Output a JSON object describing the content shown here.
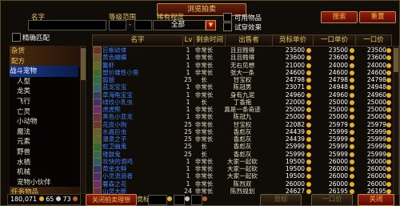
{
  "window": {
    "title": "浏览拍卖"
  },
  "filters": {
    "name_label": "名字",
    "level_label": "等级范围",
    "level_sep": "-",
    "rarity_label": "稀有程度",
    "rarity_value": "全部",
    "usable_label": "可用物品",
    "preview_label": "试穿效果",
    "exact_label": "精确匹配",
    "search_button": "搜索",
    "reset_button": "重置"
  },
  "columns": {
    "name": "名字",
    "level": "Lv",
    "time": "剩余时间",
    "seller": "出售者",
    "bid": "竞标单价",
    "buyout": "一口单价",
    "buyout2": "一口价"
  },
  "categories": [
    {
      "label": "杂货",
      "type": "main"
    },
    {
      "label": "配方",
      "type": "main"
    },
    {
      "label": "战斗宠物",
      "type": "sel"
    },
    {
      "label": "人型",
      "type": "sub"
    },
    {
      "label": "龙类",
      "type": "sub"
    },
    {
      "label": "飞行",
      "type": "sub"
    },
    {
      "label": "亡灵",
      "type": "sub"
    },
    {
      "label": "小动物",
      "type": "sub"
    },
    {
      "label": "魔法",
      "type": "sub"
    },
    {
      "label": "元素",
      "type": "sub"
    },
    {
      "label": "野兽",
      "type": "sub"
    },
    {
      "label": "水栖",
      "type": "sub"
    },
    {
      "label": "机械",
      "type": "sub"
    },
    {
      "label": "宠物小伙伴",
      "type": "sub"
    },
    {
      "label": "任务物品",
      "type": "main"
    }
  ],
  "rows": [
    {
      "name": "巨蜥幼体",
      "lv": "1",
      "time": "非常长",
      "seller": "且且贱得",
      "bid": "23500",
      "buy": "23500",
      "buy2": "23500",
      "color": "#3a80ff"
    },
    {
      "name": "黄色蝴蝶",
      "lv": "1",
      "time": "非常长",
      "seller": "且且贱得",
      "bid": "23600",
      "buy": "23600",
      "buy2": "23600",
      "color": "#3a80ff"
    },
    {
      "name": "鳌虾",
      "lv": "1",
      "time": "非常长",
      "seller": "无右见想",
      "bid": "21000",
      "buy": "24000",
      "buy2": "24000",
      "color": "#3a80ff"
    },
    {
      "name": "塑价雄性小鱼",
      "lv": "1",
      "time": "非常长",
      "seller": "张大一条",
      "bid": "24600",
      "buy": "24600",
      "buy2": "24600",
      "color": "#3a80ff"
    },
    {
      "name": "狐狼",
      "lv": "25",
      "time": "长",
      "seller": "甘宝权",
      "bid": "24798",
      "buy": "24798",
      "buy2": "24798",
      "color": "#3a80ff"
    },
    {
      "name": "蓝龙宝宝",
      "lv": "1",
      "time": "非常长",
      "seller": "陈冠男",
      "bid": "23071",
      "buy": "24948",
      "buy2": "24948",
      "color": "#3a80ff"
    },
    {
      "name": "草海龟宝宝",
      "lv": "1",
      "time": "非常长",
      "seller": "身有九泥",
      "bid": "24960",
      "buy": "24960",
      "buy2": "24960",
      "color": "#3a80ff"
    },
    {
      "name": "绿纹小乳虫",
      "lv": "1",
      "time": "长",
      "seller": "丁香拖",
      "bid": "22000",
      "buy": "25000",
      "buy2": "25000",
      "color": "#3a80ff"
    },
    {
      "name": "虎虎熊",
      "lv": "1",
      "time": "非常长",
      "seller": "真是一条奇迹",
      "bid": "25000",
      "buy": "25000",
      "buy2": "25000",
      "color": "#3a80ff"
    },
    {
      "name": "黑色小亚龙",
      "lv": "1",
      "time": "非常长",
      "seller": "陈冠九",
      "bid": "25000",
      "buy": "25000",
      "buy2": "25000",
      "color": "#3a80ff"
    },
    {
      "name": "花皮小狗",
      "lv": "25",
      "time": "非常长",
      "seller": "甘宝权",
      "bid": "22082",
      "buy": "25979",
      "buy2": "25979",
      "color": "#3a80ff"
    },
    {
      "name": "水晶巨虫",
      "lv": "25",
      "time": "非常长",
      "seller": "香彪灰",
      "bid": "24439",
      "buy": "25999",
      "buy2": "25999",
      "color": "#3a80ff"
    },
    {
      "name": "潮泉之子",
      "lv": "25",
      "time": "非常长",
      "seller": "香彪灰",
      "bid": "24439",
      "buy": "25999",
      "buy2": "25999",
      "color": "#3a80ff"
    },
    {
      "name": "蛇卫幽鬼",
      "lv": "25",
      "time": "长",
      "seller": "香彪灰",
      "bid": "25999",
      "buy": "25999",
      "buy2": "25999",
      "color": "#3a80ff"
    },
    {
      "name": "锥鼓鬼",
      "lv": "25",
      "time": "长",
      "seller": "香彪灰",
      "bid": "25999",
      "buy": "25999",
      "buy2": "25999",
      "color": "#3a80ff"
    },
    {
      "name": "欢快的酒鸡",
      "lv": "1",
      "time": "非常长",
      "seller": "大家一起砍",
      "bid": "19500",
      "buy": "26000",
      "buy2": "26000",
      "color": "#3a80ff"
    },
    {
      "name": "黄金太鲜",
      "lv": "1",
      "time": "非常长",
      "seller": "大家一起砍",
      "bid": "19500",
      "buy": "26000",
      "buy2": "26000",
      "color": "#3a80ff"
    },
    {
      "name": "小灵流浪者",
      "lv": "1",
      "time": "非常长",
      "seller": "大家一起砍",
      "bid": "19500",
      "buy": "26000",
      "buy2": "26000",
      "color": "#3a80ff"
    },
    {
      "name": "蔓森之花",
      "lv": "1",
      "time": "非常长",
      "seller": "陈烈双",
      "bid": "26000",
      "buy": "26000",
      "buy2": "26000",
      "color": "#3a80ff"
    },
    {
      "name": "山灵大胖",
      "lv": "24",
      "time": "非常长",
      "seller": "陈烈规划",
      "bid": "24627",
      "buy": "26195",
      "buy2": "26195",
      "color": "#3a80ff"
    }
  ],
  "bottom": {
    "money": "180,071",
    "silver": "65",
    "copper": "73",
    "tab_active": "关闭拍卖理想",
    "bid_label": "竞标",
    "bid_button": "竞标",
    "buyout_button": "一口价",
    "close_button": "关闭"
  }
}
